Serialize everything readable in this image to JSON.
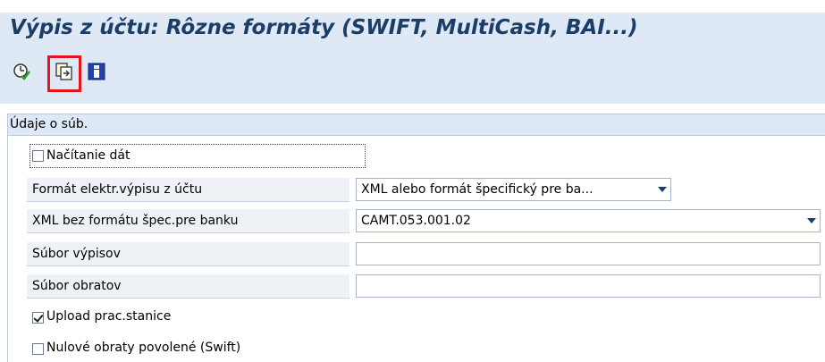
{
  "window": {
    "title": "Výpis z účtu: Rôzne formáty (SWIFT, MultiCash, BAI...)"
  },
  "toolbar": {
    "buttons": [
      {
        "name": "execute-icon"
      },
      {
        "name": "multiple-selection-icon",
        "highlighted": true
      },
      {
        "name": "info-icon"
      }
    ]
  },
  "group": {
    "header": "Údaje o súb."
  },
  "form": {
    "load_data": {
      "label": "Načítanie dát",
      "checked": false
    },
    "statement_format": {
      "label": "Formát elektr.výpisu z účtu",
      "value": "XML alebo formát špecifický pre ba..."
    },
    "xml_format": {
      "label": "XML bez formátu špec.pre banku",
      "value": "CAMT.053.001.02"
    },
    "statement_file": {
      "label": "Súbor výpisov",
      "value": ""
    },
    "turnover_file": {
      "label": "Súbor obratov",
      "value": ""
    },
    "upload_pc": {
      "label": "Upload prac.stanice",
      "checked": true
    },
    "zero_turnover": {
      "label": "Nulové obraty povolené (Swift)",
      "checked": false
    }
  },
  "colors": {
    "title": "#1b3e69",
    "toolbar_bg": "#dfe9f5",
    "highlight": "#e4141f"
  }
}
